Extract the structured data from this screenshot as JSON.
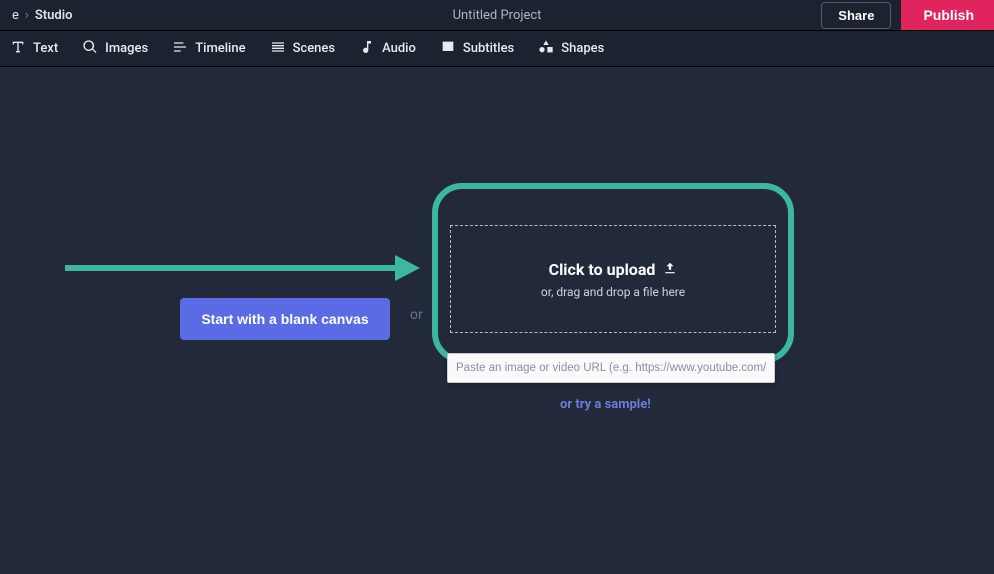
{
  "breadcrumb": {
    "home": "e",
    "studio": "Studio"
  },
  "project_title": "Untitled Project",
  "actions": {
    "share": "Share",
    "publish": "Publish"
  },
  "toolbar": {
    "text": "Text",
    "images": "Images",
    "timeline": "Timeline",
    "scenes": "Scenes",
    "audio": "Audio",
    "subtitles": "Subtitles",
    "shapes": "Shapes"
  },
  "canvas": {
    "blank_button": "Start with a blank canvas",
    "or": "or",
    "upload_title": "Click to upload",
    "upload_sub": "or, drag and drop a file here",
    "url_placeholder": "Paste an image or video URL (e.g. https://www.youtube.com/",
    "sample_link": "or try a sample!"
  }
}
